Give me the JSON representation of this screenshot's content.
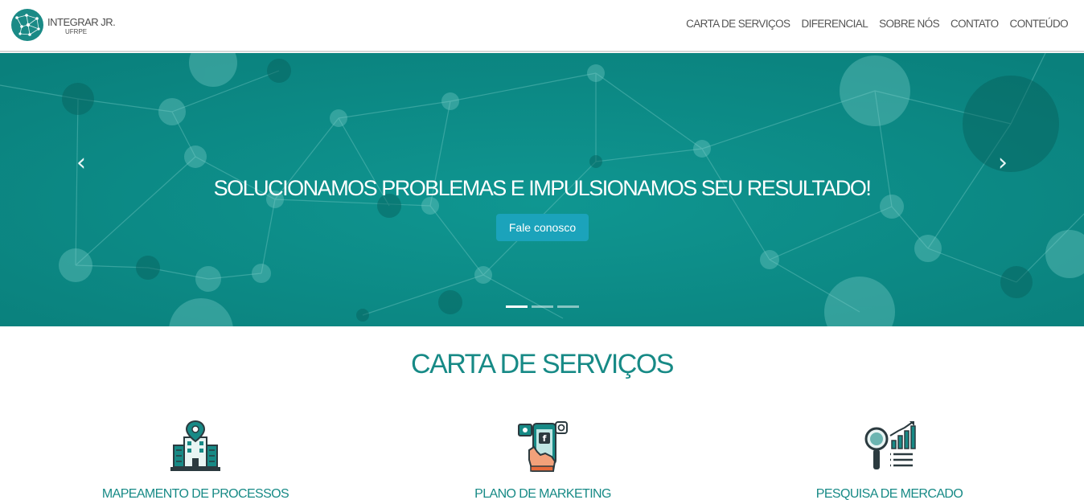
{
  "header": {
    "logo": {
      "title": "INTEGRAR JR.",
      "subtitle": "UFRPE",
      "icon": "network-globe-icon"
    },
    "nav": [
      {
        "label": "CARTA DE SERVIÇOS"
      },
      {
        "label": "DIFERENCIAL"
      },
      {
        "label": "SOBRE NÓS"
      },
      {
        "label": "CONTATO"
      },
      {
        "label": "CONTEÚDO"
      }
    ]
  },
  "hero": {
    "title": "SOLUCIONAMOS PROBLEMAS E IMPULSIONAMOS SEU RESULTADO!",
    "cta_label": "Fale conosco",
    "prev_icon": "chevron-left-icon",
    "next_icon": "chevron-right-icon",
    "prev_glyph": "‹",
    "next_glyph": "›",
    "slides_total": 3,
    "active_slide": 1,
    "colors": {
      "background": "#0d8c88",
      "button": "#1ba3bb"
    }
  },
  "services": {
    "title": "CARTA DE SERVIÇOS",
    "items": [
      {
        "label": "MAPEAMENTO DE PROCESSOS",
        "icon": "building-map-pin-icon"
      },
      {
        "label": "PLANO DE MARKETING",
        "icon": "phone-social-media-icon"
      },
      {
        "label": "PESQUISA DE MERCADO",
        "icon": "magnifier-chart-icon"
      }
    ],
    "accent_color": "#178a86"
  }
}
